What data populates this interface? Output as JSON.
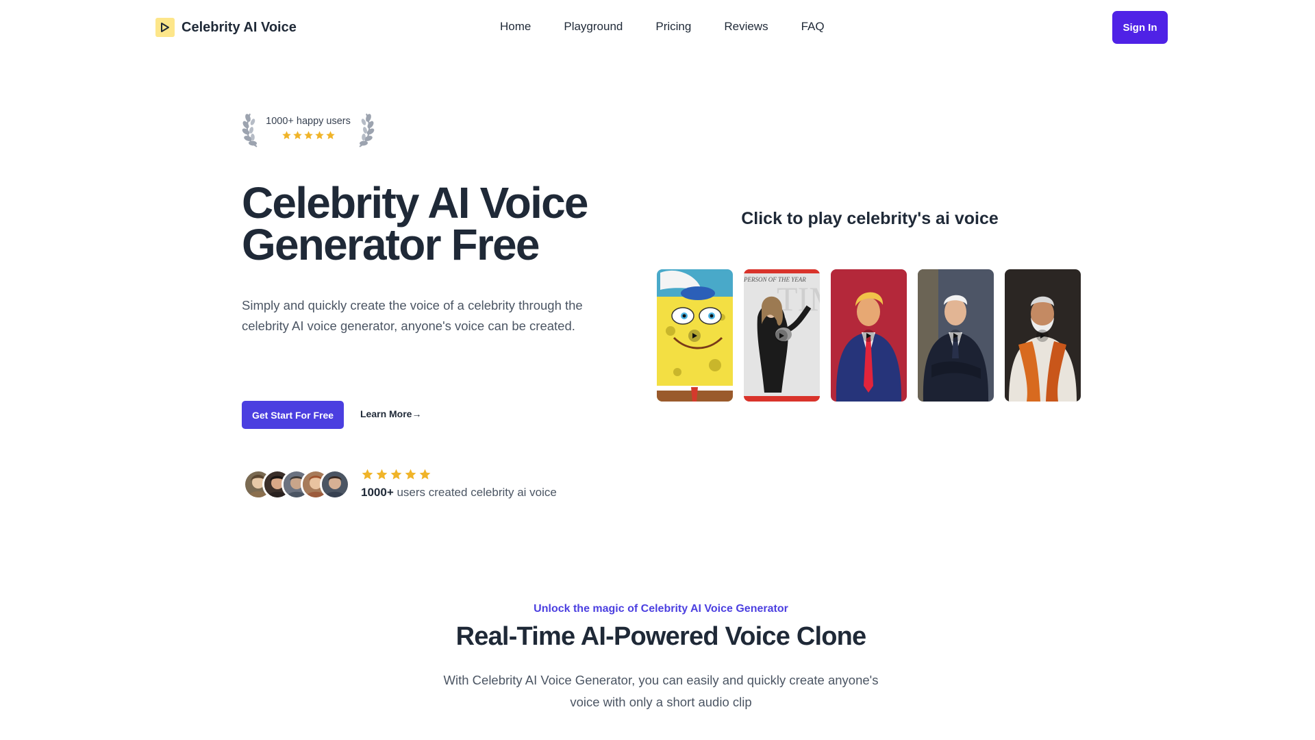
{
  "nav": {
    "brand": "Celebrity AI Voice",
    "links": [
      "Home",
      "Playground",
      "Pricing",
      "Reviews",
      "FAQ"
    ],
    "sign_in": "Sign In"
  },
  "hero": {
    "badge_text": "1000+ happy users",
    "badge_rating": 5,
    "title_line1": "Celebrity AI Voice",
    "title_line2": "Generator Free",
    "description": "Simply and quickly create the voice of a celebrity through the celebrity AI voice generator, anyone's voice can be created.",
    "cta_label": "Get Start For Free",
    "learn_more": "Learn More→",
    "proof_rating": 5,
    "proof_count": "1000+",
    "proof_text": " users created celebrity ai voice"
  },
  "voices": {
    "heading": "Click to play celebrity's ai voice",
    "cards": [
      {
        "name": "spongebob-card",
        "bg": "#f4e04d"
      },
      {
        "name": "time-cover-card",
        "bg": "#d9d9d9",
        "cover_text": "PERSON OF THE YEAR"
      },
      {
        "name": "president-red-card",
        "bg": "#b4283a"
      },
      {
        "name": "president-navy-card",
        "bg": "#3a4150"
      },
      {
        "name": "leader-orange-card",
        "bg": "#2a2a2a"
      }
    ]
  },
  "section2": {
    "eyebrow": "Unlock the magic of Celebrity AI Voice Generator",
    "title": "Real-Time AI-Powered Voice Clone",
    "description": "With Celebrity AI Voice Generator, you can easily and quickly create anyone's voice with only a short audio clip"
  },
  "colors": {
    "accent": "#4f22e6",
    "cta": "#4b3fe0",
    "star": "#f0b429",
    "logo_bg": "#fde68a"
  }
}
